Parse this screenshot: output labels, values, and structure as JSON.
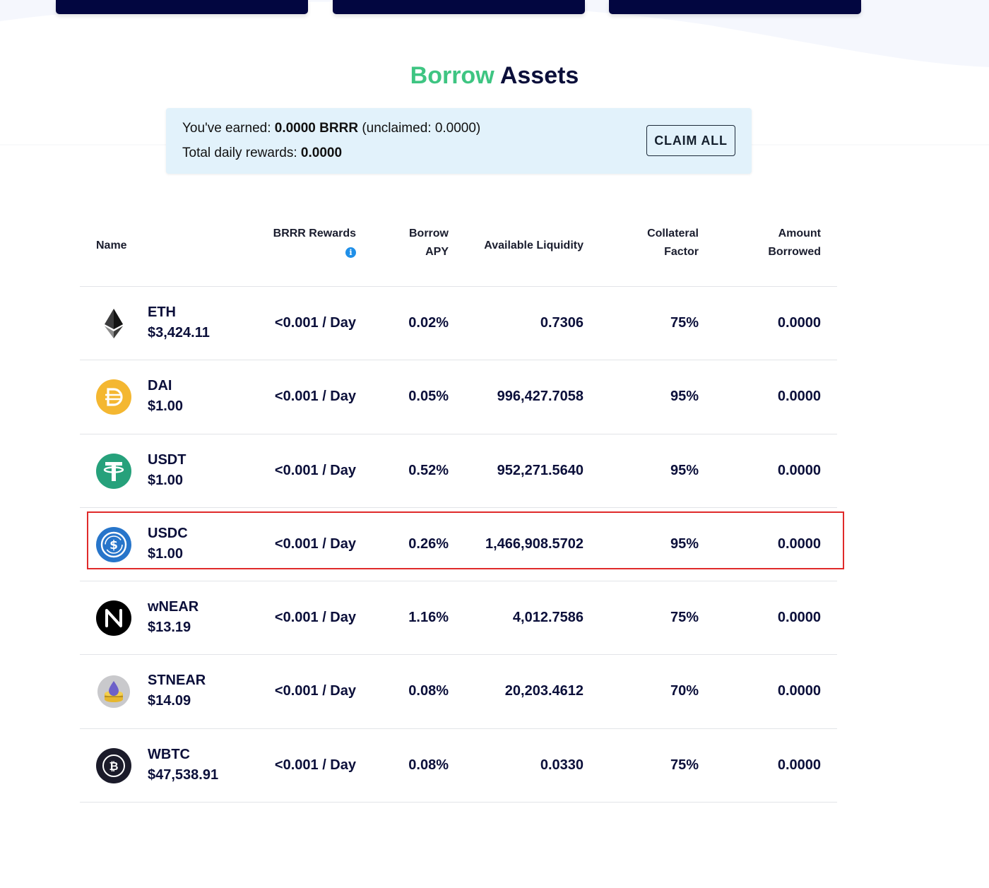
{
  "page": {
    "title_accent": "Borrow",
    "title_rest": " Assets"
  },
  "rewards": {
    "earned_prefix": "You've earned: ",
    "earned_value": "0.0000 BRRR",
    "unclaimed_text": " (unclaimed:  0.0000)",
    "daily_prefix": "Total daily rewards: ",
    "daily_value": "0.0000",
    "claim_label": "CLAIM ALL"
  },
  "table": {
    "headers": {
      "name": "Name",
      "rewards": "BRRR Rewards",
      "apy_1": "Borrow",
      "apy_2": "APY",
      "liquidity": "Available Liquidity",
      "collateral_1": "Collateral",
      "collateral_2": "Factor",
      "amount_1": "Amount",
      "amount_2": "Borrowed",
      "info_icon": "i"
    },
    "rows": [
      {
        "symbol": "ETH",
        "price": "$3,424.11",
        "rewards": "<0.001 / Day",
        "apy": "0.02%",
        "liquidity": "0.7306",
        "collateral": "75%",
        "borrowed": "0.0000",
        "icon": "ethereum-icon"
      },
      {
        "symbol": "DAI",
        "price": "$1.00",
        "rewards": "<0.001 / Day",
        "apy": "0.05%",
        "liquidity": "996,427.7058",
        "collateral": "95%",
        "borrowed": "0.0000",
        "icon": "dai-icon"
      },
      {
        "symbol": "USDT",
        "price": "$1.00",
        "rewards": "<0.001 / Day",
        "apy": "0.52%",
        "liquidity": "952,271.5640",
        "collateral": "95%",
        "borrowed": "0.0000",
        "icon": "tether-icon"
      },
      {
        "symbol": "USDC",
        "price": "$1.00",
        "rewards": "<0.001 / Day",
        "apy": "0.26%",
        "liquidity": "1,466,908.5702",
        "collateral": "95%",
        "borrowed": "0.0000",
        "icon": "usdc-icon"
      },
      {
        "symbol": "wNEAR",
        "price": "$13.19",
        "rewards": "<0.001 / Day",
        "apy": "1.16%",
        "liquidity": "4,012.7586",
        "collateral": "75%",
        "borrowed": "0.0000",
        "icon": "near-icon"
      },
      {
        "symbol": "STNEAR",
        "price": "$14.09",
        "rewards": "<0.001 / Day",
        "apy": "0.08%",
        "liquidity": "20,203.4612",
        "collateral": "70%",
        "borrowed": "0.0000",
        "icon": "stnear-icon"
      },
      {
        "symbol": "WBTC",
        "price": "$47,538.91",
        "rewards": "<0.001 / Day",
        "apy": "0.08%",
        "liquidity": "0.0330",
        "collateral": "75%",
        "borrowed": "0.0000",
        "icon": "bitcoin-icon"
      }
    ]
  },
  "colors": {
    "accent_green": "#3ec582",
    "navy": "#020640",
    "banner_bg": "#e2f2fb",
    "highlight_red": "#e02a2a"
  }
}
